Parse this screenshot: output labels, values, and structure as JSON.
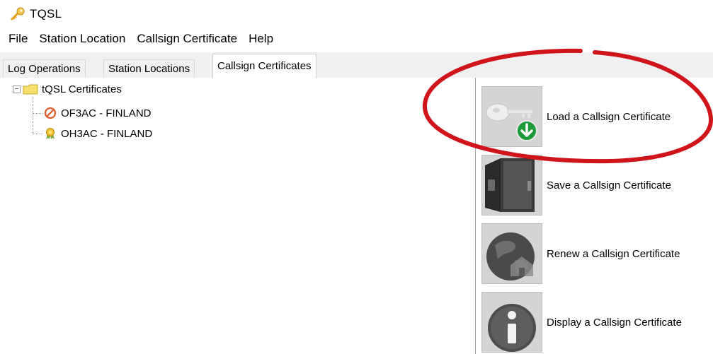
{
  "window": {
    "title": "TQSL"
  },
  "menu": [
    "File",
    "Station Location",
    "Callsign Certificate",
    "Help"
  ],
  "tabs": [
    {
      "label": "Log Operations",
      "active": false
    },
    {
      "label": "Station Locations",
      "active": false
    },
    {
      "label": "Callsign Certificates",
      "active": true
    }
  ],
  "tree": {
    "root": {
      "label": "tQSL Certificates",
      "icon": "folder-icon",
      "expanded": true
    },
    "children": [
      {
        "label": "OF3AC - FINLAND",
        "icon": "prohibited-icon"
      },
      {
        "label": "OH3AC - FINLAND",
        "icon": "certificate-badge-icon"
      }
    ]
  },
  "actions": [
    {
      "label": "Load a Callsign Certificate",
      "icon": "key-download-icon"
    },
    {
      "label": "Save a Callsign Certificate",
      "icon": "safe-door-icon"
    },
    {
      "label": "Renew a Callsign Certificate",
      "icon": "globe-home-icon"
    },
    {
      "label": "Display a Callsign Certificate",
      "icon": "info-icon"
    }
  ],
  "colors": {
    "tab_background": "#f0f0f0",
    "action_background": "#d4d4d4",
    "highlight_oval": "#d0141c",
    "download_badge": "#1f9a3a",
    "prohibited": "#e05a2b",
    "folder": "#f5e06b"
  }
}
